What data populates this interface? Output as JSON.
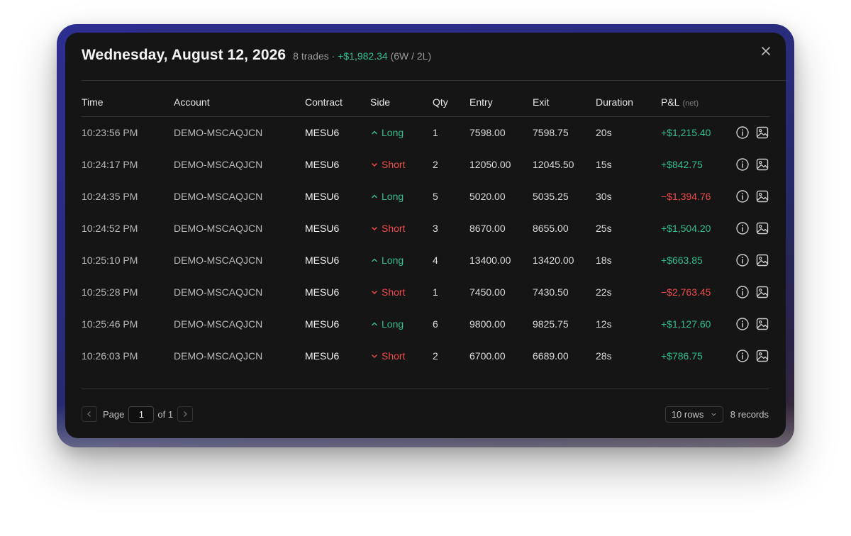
{
  "header": {
    "date_title": "Wednesday, August 12, 2026",
    "trades_count": "8 trades",
    "separator": "·",
    "total_pnl": "+$1,982.34",
    "win_loss": "(6W / 2L)"
  },
  "columns": {
    "time": "Time",
    "account": "Account",
    "contract": "Contract",
    "side": "Side",
    "qty": "Qty",
    "entry": "Entry",
    "exit": "Exit",
    "duration": "Duration",
    "pnl": "P&L",
    "pnl_sub": "(net)"
  },
  "trades": [
    {
      "time": "10:23:56 PM",
      "account": "DEMO-MSCAQJCN",
      "contract": "MESU6",
      "side": "Long",
      "qty": "1",
      "entry": "7598.00",
      "exit": "7598.75",
      "duration": "20s",
      "pnl": "+$1,215.40",
      "positive": true
    },
    {
      "time": "10:24:17 PM",
      "account": "DEMO-MSCAQJCN",
      "contract": "MESU6",
      "side": "Short",
      "qty": "2",
      "entry": "12050.00",
      "exit": "12045.50",
      "duration": "15s",
      "pnl": "+$842.75",
      "positive": true
    },
    {
      "time": "10:24:35 PM",
      "account": "DEMO-MSCAQJCN",
      "contract": "MESU6",
      "side": "Long",
      "qty": "5",
      "entry": "5020.00",
      "exit": "5035.25",
      "duration": "30s",
      "pnl": "−$1,394.76",
      "positive": false
    },
    {
      "time": "10:24:52 PM",
      "account": "DEMO-MSCAQJCN",
      "contract": "MESU6",
      "side": "Short",
      "qty": "3",
      "entry": "8670.00",
      "exit": "8655.00",
      "duration": "25s",
      "pnl": "+$1,504.20",
      "positive": true
    },
    {
      "time": "10:25:10 PM",
      "account": "DEMO-MSCAQJCN",
      "contract": "MESU6",
      "side": "Long",
      "qty": "4",
      "entry": "13400.00",
      "exit": "13420.00",
      "duration": "18s",
      "pnl": "+$663.85",
      "positive": true
    },
    {
      "time": "10:25:28 PM",
      "account": "DEMO-MSCAQJCN",
      "contract": "MESU6",
      "side": "Short",
      "qty": "1",
      "entry": "7450.00",
      "exit": "7430.50",
      "duration": "22s",
      "pnl": "−$2,763.45",
      "positive": false
    },
    {
      "time": "10:25:46 PM",
      "account": "DEMO-MSCAQJCN",
      "contract": "MESU6",
      "side": "Long",
      "qty": "6",
      "entry": "9800.00",
      "exit": "9825.75",
      "duration": "12s",
      "pnl": "+$1,127.60",
      "positive": true
    },
    {
      "time": "10:26:03 PM",
      "account": "DEMO-MSCAQJCN",
      "contract": "MESU6",
      "side": "Short",
      "qty": "2",
      "entry": "6700.00",
      "exit": "6689.00",
      "duration": "28s",
      "pnl": "+$786.75",
      "positive": true
    }
  ],
  "pagination": {
    "page_label": "Page",
    "current_page": "1",
    "of_label": "of 1",
    "rows_select": "10 rows",
    "records": "8 records"
  },
  "icons": {
    "close": "close-icon",
    "info": "info-icon",
    "image": "image-icon",
    "long": "chevron-up-icon",
    "short": "chevron-down-icon",
    "prev": "chevron-left-icon",
    "next": "chevron-right-icon"
  },
  "colors": {
    "positive": "#2fbf8a",
    "negative": "#ef4b4b",
    "panel_bg": "#151515"
  }
}
